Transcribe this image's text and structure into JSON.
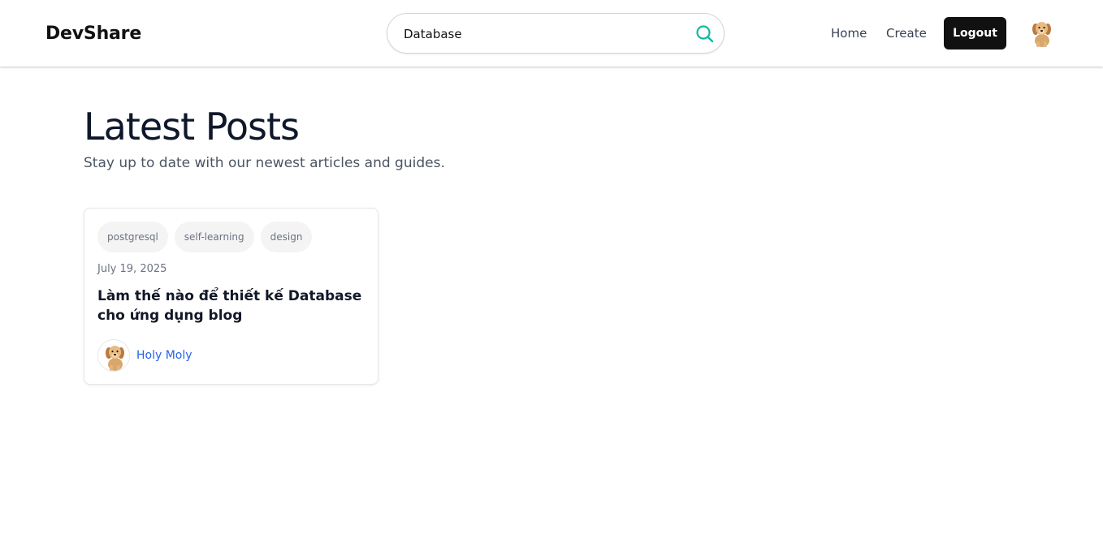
{
  "header": {
    "brand": "DevShare",
    "search": {
      "value": "Database",
      "icon": "search-icon"
    },
    "nav": {
      "home_label": "Home",
      "create_label": "Create",
      "logout_label": "Logout"
    },
    "avatar_icon": "dog-avatar-icon"
  },
  "main": {
    "title": "Latest Posts",
    "subtitle": "Stay up to date with our newest articles and guides.",
    "posts": [
      {
        "tags": [
          "postgresql",
          "self-learning",
          "design"
        ],
        "date": "July 19, 2025",
        "title": "Làm thế nào để thiết kế Database cho ứng dụng blog",
        "author": "Holy Moly",
        "author_avatar_icon": "dog-avatar-icon"
      }
    ]
  },
  "colors": {
    "accent": "#14b8a6",
    "button_bg": "#111111",
    "author_link": "#2563eb"
  }
}
